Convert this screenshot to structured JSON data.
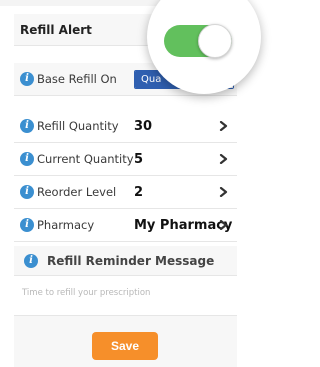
{
  "refill_alert": {
    "label": "Refill Alert",
    "enabled": true
  },
  "base_refill": {
    "label": "Base Refill On",
    "selected_option": "Qua"
  },
  "rows": [
    {
      "label": "Refill Quantity",
      "value": "30"
    },
    {
      "label": "Current Quantity",
      "value": "5"
    },
    {
      "label": "Reorder Level",
      "value": "2"
    },
    {
      "label": "Pharmacy",
      "value": "My Pharmacy"
    }
  ],
  "reminder": {
    "title": "Refill Reminder Message",
    "placeholder": "Time to refill your prescription"
  },
  "save_label": "Save",
  "colors": {
    "accent_blue": "#3b8fd0",
    "toggle_green": "#62c05d",
    "save_orange": "#f68f2a",
    "segment_blue": "#2f5fb0"
  },
  "icons": {
    "info": "info-icon",
    "chevron": "chevron-right-icon"
  }
}
